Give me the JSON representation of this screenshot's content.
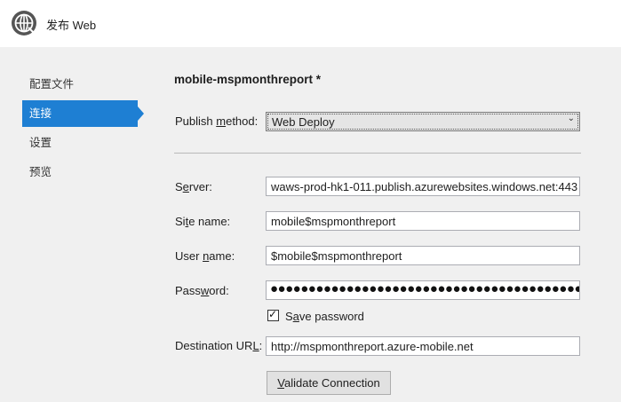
{
  "window": {
    "title": "发布 Web"
  },
  "nav": {
    "items": [
      {
        "label": "配置文件"
      },
      {
        "label": "连接"
      },
      {
        "label": "设置"
      },
      {
        "label": "预览"
      }
    ],
    "active_index": 1
  },
  "profile": {
    "title": "mobile-mspmonthreport *"
  },
  "publish_method": {
    "label_prefix": "Publish ",
    "label_accel": "m",
    "label_suffix": "ethod:",
    "selected": "Web Deploy"
  },
  "form": {
    "server": {
      "label_prefix": "S",
      "label_accel": "e",
      "label_suffix": "rver:",
      "value": "waws-prod-hk1-011.publish.azurewebsites.windows.net:443"
    },
    "site_name": {
      "label_prefix": "Si",
      "label_accel": "t",
      "label_suffix": "e name:",
      "value": "mobile$mspmonthreport"
    },
    "user_name": {
      "label_prefix": "User ",
      "label_accel": "n",
      "label_suffix": "ame:",
      "value": "$mobile$mspmonthreport"
    },
    "password": {
      "label_prefix": "Pass",
      "label_accel": "w",
      "label_suffix": "ord:",
      "masked": "●●●●●●●●●●●●●●●●●●●●●●●●●●●●●●●●●●●●●●●●●●●●●●●●●●●●●●●●●●●●"
    },
    "save_password": {
      "label_prefix": "S",
      "label_accel": "a",
      "label_suffix": "ve password",
      "checked": true
    },
    "destination_url": {
      "label_prefix": "Destination UR",
      "label_accel": "L",
      "label_suffix": ":",
      "value": "http://mspmonthreport.azure-mobile.net"
    }
  },
  "validate_button": {
    "label_prefix": "",
    "label_accel": "V",
    "label_suffix": "alidate Connection"
  },
  "colors": {
    "accent": "#1e7fd3",
    "background": "#f0f0f0"
  },
  "icons": {
    "app": "globe-icon",
    "dropdown": "chevron-down-icon",
    "check": "checkmark-icon"
  }
}
